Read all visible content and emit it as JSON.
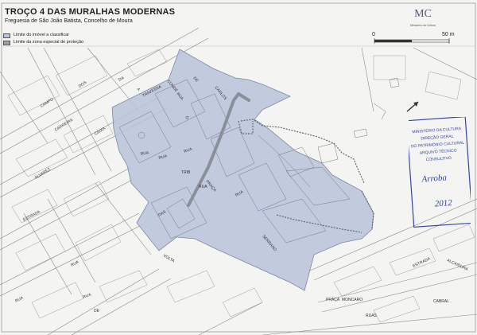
{
  "header": {
    "title": "TROÇO 4 DAS MURALHAS MODERNAS",
    "subtitle": "Freguesia de São João Batista, Concelho de Moura"
  },
  "legend": {
    "items": [
      {
        "label": "Limite do imóvel a classificar",
        "color": "#b9c3da"
      },
      {
        "label": "Limite da zona especial de proteção",
        "color": "#9aa0a8"
      }
    ]
  },
  "logo": {
    "mark": "MC",
    "caption": "Ministério da Cultura"
  },
  "scale": {
    "start": "0",
    "end": "50 m"
  },
  "map": {
    "zone_color": "#b9c3da",
    "street_labels": [
      {
        "text": "CAMPO",
        "rot": -32
      },
      {
        "text": "DOS",
        "rot": -32
      },
      {
        "text": "ALVAREZ",
        "rot": -32
      },
      {
        "text": "CAIXA",
        "rot": -32
      },
      {
        "text": "ESTRADA",
        "rot": -28
      },
      {
        "text": "TRAVESSA",
        "rot": -28
      },
      {
        "text": "DA",
        "rot": -28
      },
      {
        "text": "CARREIRA",
        "rot": -32
      },
      {
        "text": "RUA",
        "rot": -28
      },
      {
        "text": "RUA",
        "rot": -28
      },
      {
        "text": "A",
        "rot": 50
      },
      {
        "text": "CONDE",
        "rot": 50
      },
      {
        "text": "RUA",
        "rot": 50
      },
      {
        "text": "DE",
        "rot": 50
      },
      {
        "text": "D.",
        "rot": -60
      },
      {
        "text": "CARLOS",
        "rot": 50
      },
      {
        "text": "TRIB",
        "rot": 0
      },
      {
        "text": "PRAÇA",
        "rot": 50
      },
      {
        "text": "RUA",
        "rot": -30
      },
      {
        "text": "DAS",
        "rot": -30
      },
      {
        "text": "VOLTA",
        "rot": 30
      },
      {
        "text": "SERRANO",
        "rot": 50
      },
      {
        "text": "ESTRADA",
        "rot": -25
      },
      {
        "text": "ALCAIDURA",
        "rot": 25
      },
      {
        "text": "MONCARO",
        "rot": 0
      },
      {
        "text": "PRAÇA",
        "rot": 0
      },
      {
        "text": "CABRAL",
        "rot": 0
      },
      {
        "text": "RUAS",
        "rot": 0
      },
      {
        "text": "RUA",
        "rot": -20
      },
      {
        "text": "RUA",
        "rot": -15
      },
      {
        "text": "RUA",
        "rot": -10
      },
      {
        "text": "RUA",
        "rot": 0
      },
      {
        "text": "DE",
        "rot": 0
      },
      {
        "text": "RUA",
        "rot": -20
      },
      {
        "text": "RUA",
        "rot": -30
      }
    ]
  },
  "stamp": {
    "lines": [
      "MINISTÉRIO DA CULTURA",
      "DIREÇÃO GERAL",
      "DO PATRIMÓNIO CULTURAL",
      "ARQUIVO TÉCNICO",
      "CONSULTIVO"
    ],
    "handwriting": [
      "Arroba",
      "2012"
    ],
    "color": "#3344aa"
  }
}
